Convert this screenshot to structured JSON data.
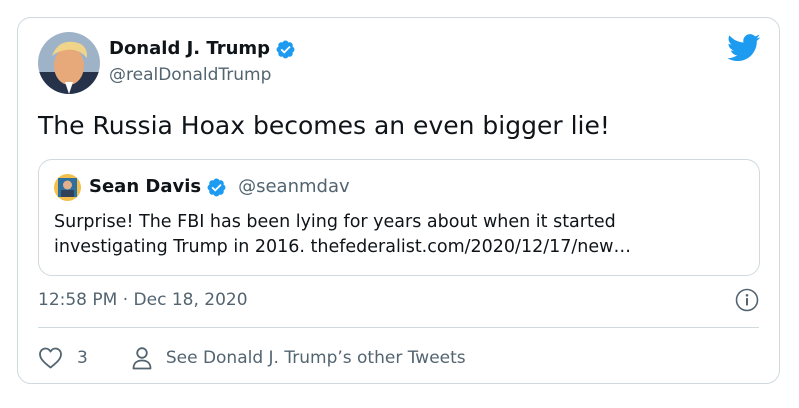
{
  "author": {
    "name": "Donald J. Trump",
    "handle": "@realDonaldTrump",
    "verified": true
  },
  "tweet_text": "The Russia Hoax becomes an even bigger lie!",
  "quoted_tweet": {
    "name": "Sean Davis",
    "handle": "@seanmdav",
    "verified": true,
    "text_lines": [
      "Surprise! The FBI has been lying for years about when it started",
      "investigating Trump in 2016. thefederalist.com/2020/12/17/new…"
    ]
  },
  "timestamp": "12:58 PM · Dec 18, 2020",
  "actions": {
    "like_count": "3",
    "see_more_label": "See Donald J. Trump’s other Tweets"
  },
  "icons": {
    "logo": "twitter-bird-icon",
    "verified": "verified-badge-icon",
    "info": "info-icon",
    "like": "heart-icon",
    "profile": "person-icon"
  },
  "colors": {
    "brand_blue": "#1d9bf0",
    "text_primary": "#0f1419",
    "text_secondary": "#536471",
    "border": "#cfd9de"
  }
}
